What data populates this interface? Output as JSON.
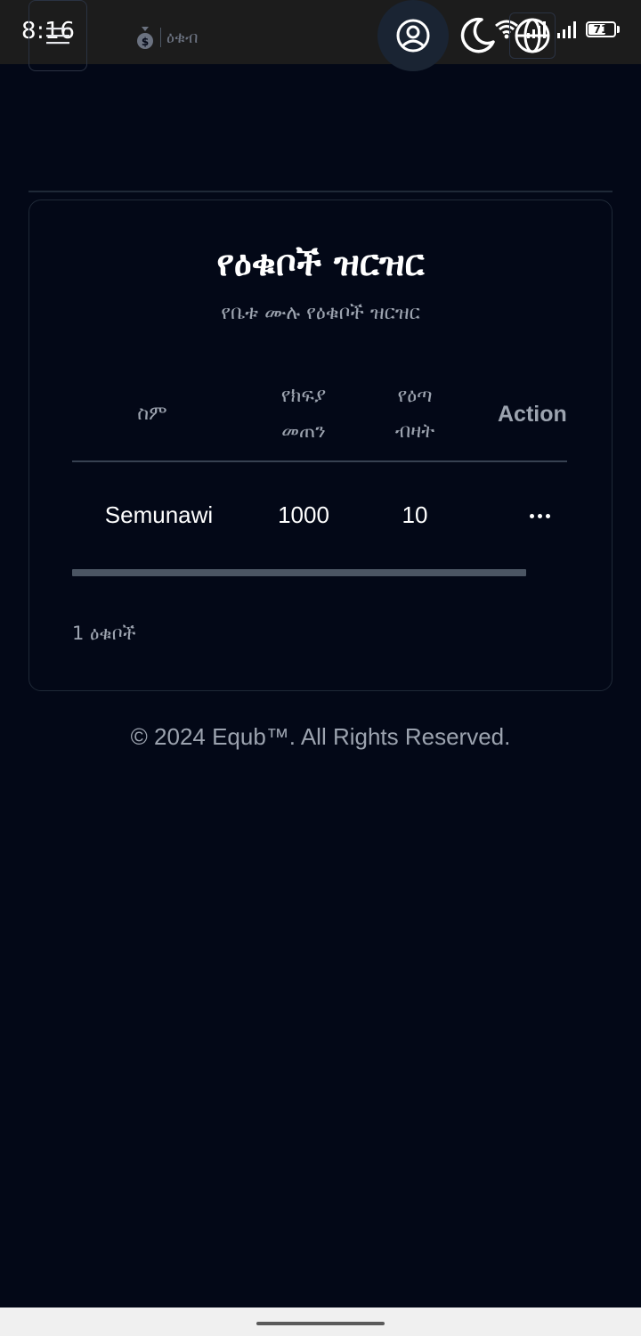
{
  "status_bar": {
    "time": "8:16",
    "battery_level": "71",
    "battery_percent": 71,
    "icons": [
      "wifi-icon",
      "signal-icon",
      "signal-icon",
      "battery-icon"
    ]
  },
  "header": {
    "menu_icon": "hamburger-menu-icon",
    "logo_text": "ዕቁብ",
    "profile_icon": "user-circle-icon",
    "theme_icon": "moon-icon",
    "language_icon": "globe-icon"
  },
  "card": {
    "title": "የዕቁቦች ዝርዝር",
    "subtitle": "የቤቱ ሙሉ የዕቁቦች ዝርዝር",
    "table": {
      "columns": [
        {
          "label": "ስም"
        },
        {
          "label_line1": "የክፍያ",
          "label_line2": "መጠን"
        },
        {
          "label_line1": "የዕጣ",
          "label_line2": "ብዛት"
        },
        {
          "label": "Action"
        }
      ],
      "rows": [
        {
          "name": "Semunawi",
          "amount": "1000",
          "lot_count": "10",
          "action_icon": "more-horizontal-icon"
        }
      ]
    },
    "count_text": "1 ዕቁቦች"
  },
  "footer": {
    "copyright": "© 2024 Equb™. All Rights Reserved."
  },
  "colors": {
    "background": "#030817",
    "card_border": "#1f2937",
    "muted_text": "#9ca3af",
    "primary_text": "#ffffff"
  }
}
